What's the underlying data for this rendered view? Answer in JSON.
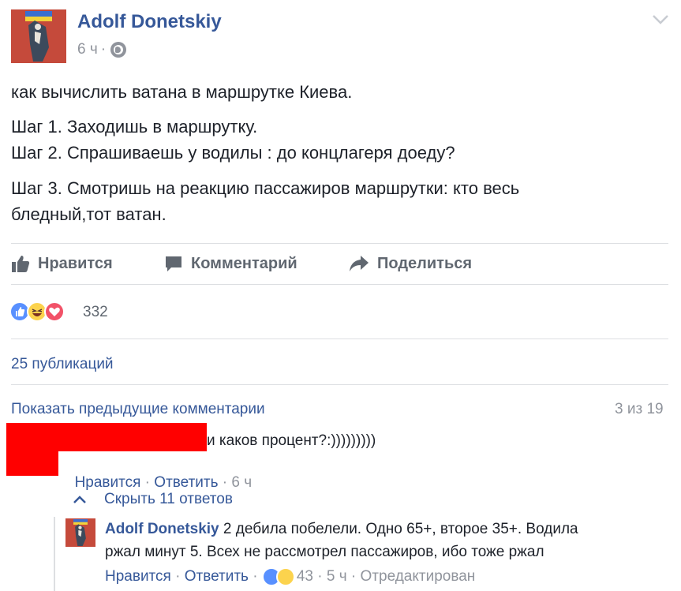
{
  "post": {
    "author": "Adolf Donetskiy",
    "time": "6 ч",
    "dot": "·",
    "paragraphs": [
      "как вычислить ватана в маршрутке Киева.",
      "Шаг 1. Заходишь в маршрутку.\nШаг 2. Спрашиваешь у водилы : до концлагеря доеду?",
      "Шаг 3. Смотришь на реакцию пассажиров маршрутки: кто весь\nбледный,тот ватан."
    ]
  },
  "actions": {
    "like": "Нравится",
    "comment": "Комментарий",
    "share": "Поделиться"
  },
  "reactions": {
    "types": [
      "like",
      "haha",
      "love"
    ],
    "count": "332"
  },
  "shares": "25 публикаций",
  "comments": {
    "show_previous": "Показать предыдущие комментарии",
    "counter": "3 из 19",
    "first": {
      "text": "и каков процент?:)))))))))",
      "like": "Нравится",
      "reply": "Ответить",
      "time": "6 ч"
    },
    "hide_replies": "Скрыть 11 ответов",
    "reply": {
      "author": "Adolf Donetskiy",
      "text_line1": "2 дебила побелели. Одно 65+, второе 35+. Водила",
      "text_line2": "ржал минут 5. Всех не рассмотрел пассажиров, ибо тоже ржал",
      "like": "Нравится",
      "reply": "Ответить",
      "reaction_count": "43",
      "time": "5 ч",
      "edited": "Отредактирован"
    }
  },
  "colors": {
    "link": "#365899",
    "muted": "#90949c",
    "action": "#606770",
    "like_blue": "#5890ff",
    "love_red": "#f25268",
    "haha_yellow": "#fcd34d",
    "redaction": "#ff0000"
  }
}
